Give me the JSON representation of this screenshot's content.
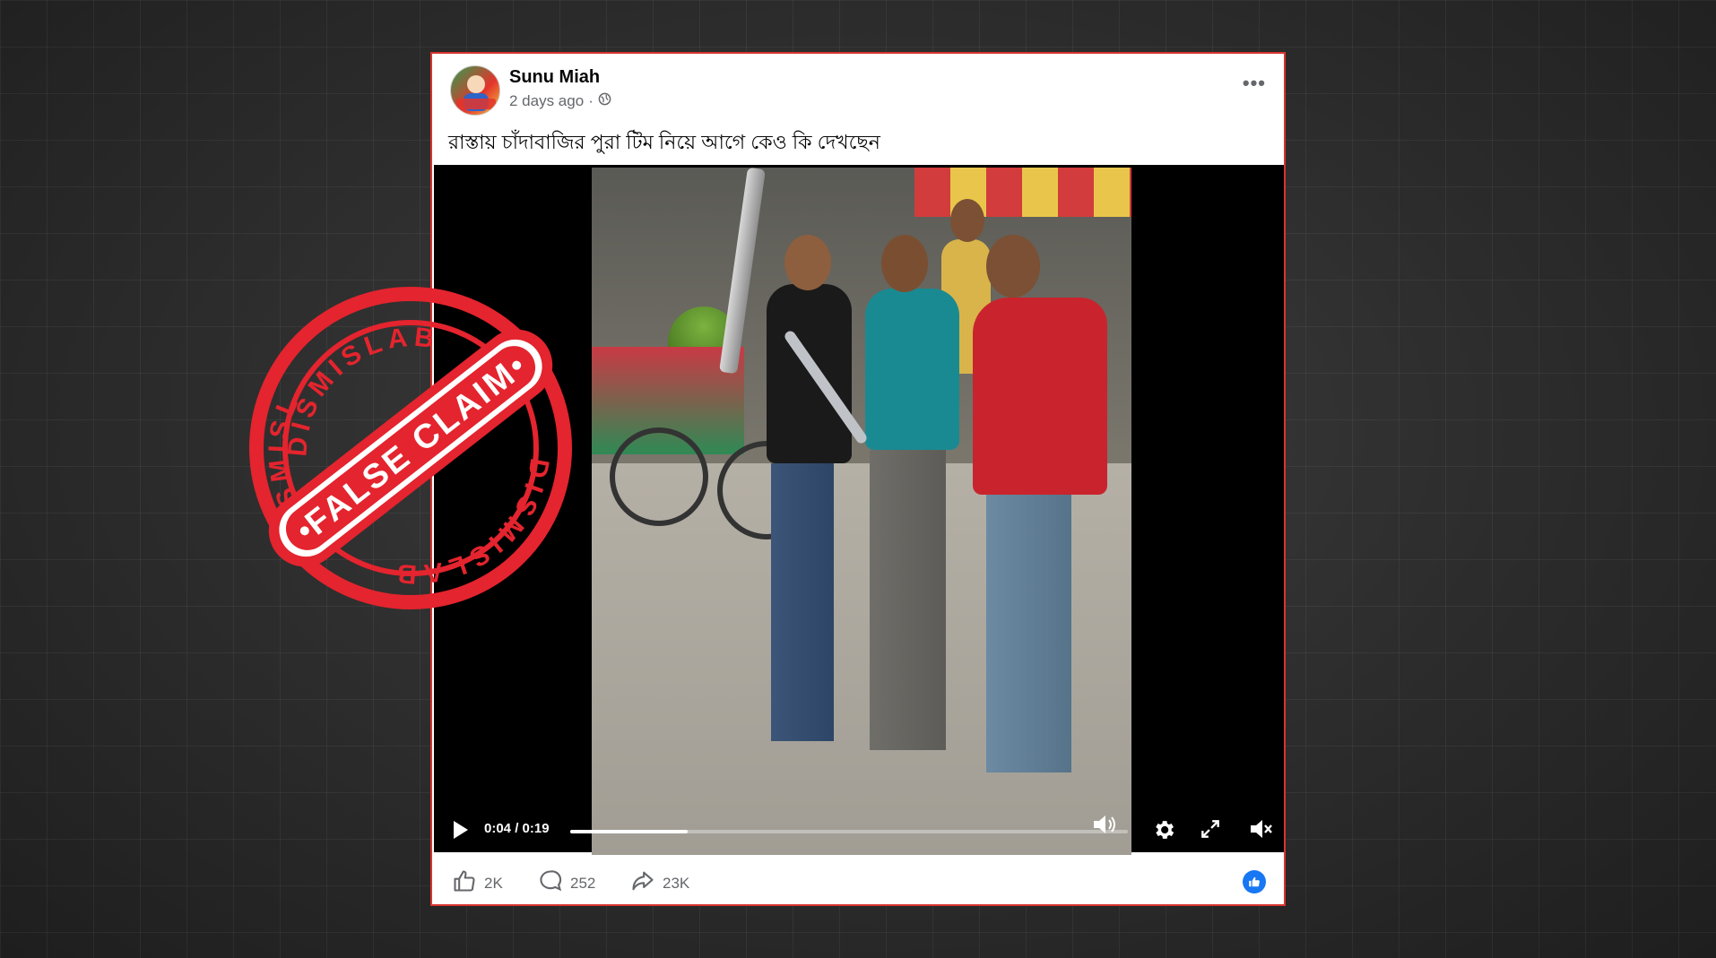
{
  "post": {
    "author": "Sunu Miah",
    "time": "2 days ago",
    "separator": "·",
    "caption": "রাস্তায় চাঁদাবাজির পুরা টিম নিয়ে আগে কেও কি দেখছেন",
    "more_label": "•••"
  },
  "video": {
    "current_time": "0:04",
    "time_sep": " / ",
    "duration": "0:19",
    "progress_fraction": 0.21
  },
  "reactions": {
    "likes": "2K",
    "comments": "252",
    "shares": "23K"
  },
  "stamp": {
    "outer_top": "DISMISLAB",
    "outer_left": "DISMISLAB",
    "outer_bottom": "DISMISLAB",
    "banner": "FALSE CLAIM",
    "color": "#e4242e"
  },
  "icons": {
    "globe": "globe-icon",
    "like": "thumbs-up-icon",
    "comment": "comment-bubble-icon",
    "share": "share-arrow-icon",
    "play": "play-icon",
    "settings": "gear-icon",
    "fullscreen": "expand-icon",
    "mute": "speaker-muted-icon",
    "like_badge": "like-badge-icon"
  }
}
